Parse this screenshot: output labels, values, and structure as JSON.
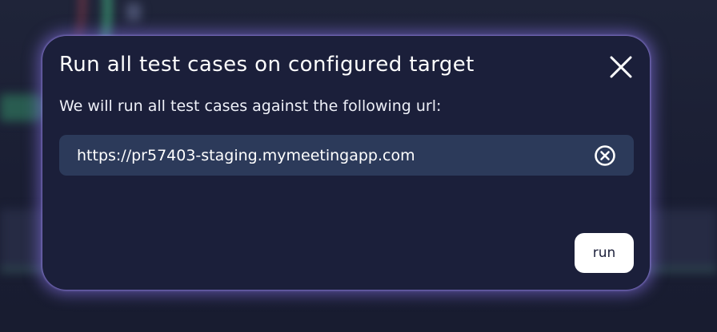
{
  "background": {
    "label": "",
    "bottom_text": ""
  },
  "dialog": {
    "title": "Run all test cases on configured target",
    "description": "We will run all test cases against the following url:",
    "url_value": "https://pr57403-staging.mymeetingapp.com",
    "run_label": "run",
    "close_icon": "close-icon",
    "clear_icon": "clear-circle-x-icon"
  },
  "colors": {
    "modal_bg": "#1b1f3a",
    "input_bg": "#2c3a5a",
    "glow": "#8773e6",
    "button_bg": "#ffffff",
    "text": "#ffffff"
  }
}
